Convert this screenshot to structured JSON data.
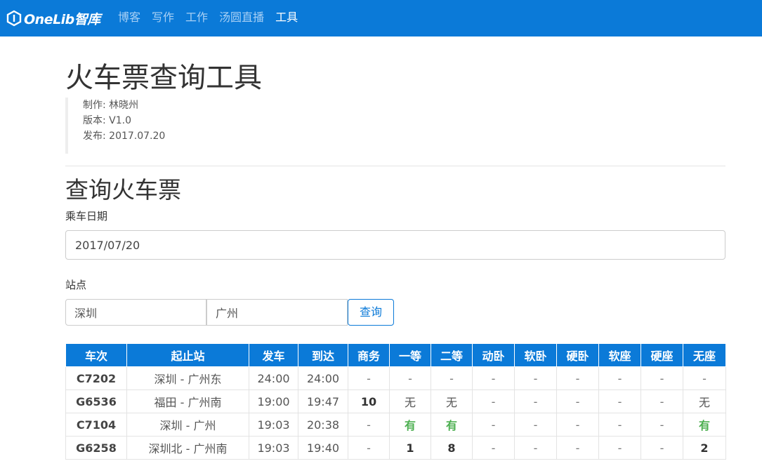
{
  "nav": {
    "logo_text": "OneLib智库",
    "links": [
      {
        "label": "博客"
      },
      {
        "label": "写作"
      },
      {
        "label": "工作"
      },
      {
        "label": "汤圆直播"
      },
      {
        "label": "工具"
      }
    ],
    "active_index": 4
  },
  "page": {
    "title": "火车票查询工具",
    "meta": {
      "author": "制作: 林晓州",
      "version": "版本: V1.0",
      "release": "发布: 2017.07.20"
    }
  },
  "query": {
    "section_title": "查询火车票",
    "date_label": "乘车日期",
    "date_value": "2017/07/20",
    "station_label": "站点",
    "from_value": "深圳",
    "to_value": "广州",
    "button_label": "查询"
  },
  "table": {
    "headers": [
      "车次",
      "起止站",
      "发车",
      "到达",
      "商务",
      "一等",
      "二等",
      "动卧",
      "软卧",
      "硬卧",
      "软座",
      "硬座",
      "无座"
    ],
    "rows": [
      [
        "C7202",
        "深圳 - 广州东",
        "24:00",
        "24:00",
        "-",
        "-",
        "-",
        "-",
        "-",
        "-",
        "-",
        "-",
        "-"
      ],
      [
        "G6536",
        "福田 - 广州南",
        "19:00",
        "19:47",
        "10",
        "无",
        "无",
        "-",
        "-",
        "-",
        "-",
        "-",
        "无"
      ],
      [
        "C7104",
        "深圳 - 广州",
        "19:03",
        "20:38",
        "-",
        "有",
        "有",
        "-",
        "-",
        "-",
        "-",
        "-",
        "有"
      ],
      [
        "G6258",
        "深圳北 - 广州南",
        "19:03",
        "19:40",
        "-",
        "1",
        "8",
        "-",
        "-",
        "-",
        "-",
        "-",
        "2"
      ]
    ]
  },
  "colors": {
    "brand": "#0b7ad8",
    "available": "#4caf50"
  }
}
